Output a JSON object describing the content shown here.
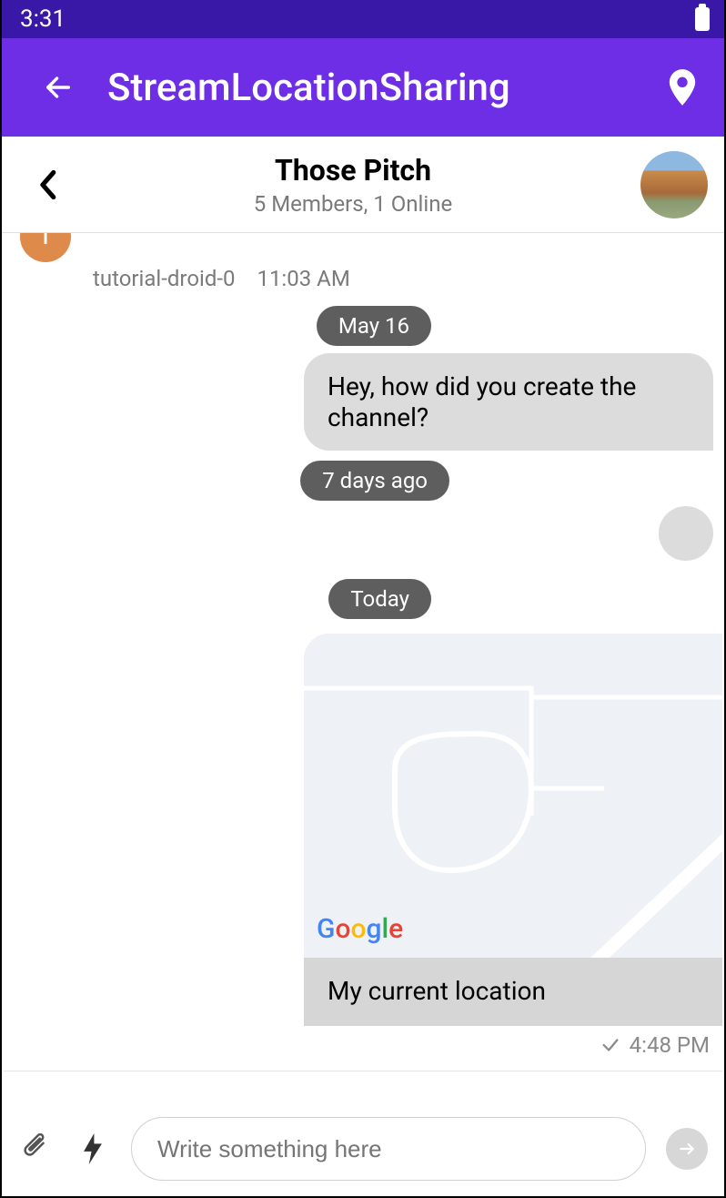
{
  "status": {
    "time": "3:31"
  },
  "appbar": {
    "title": "StreamLocationSharing"
  },
  "channel": {
    "name": "Those Pitch",
    "subtitle": "5 Members, 1 Online",
    "avatar_initial": "T"
  },
  "messages": {
    "prev_sender": "tutorial-droid-0",
    "prev_time": "11:03 AM",
    "date_pill_1": "May 16",
    "bubble_1": "Hey, how did you create the channel?",
    "date_pill_2": "7 days ago",
    "date_pill_3": "Today",
    "map_attribution": "Google",
    "map_label": "My current location",
    "sent_time": "4:48 PM"
  },
  "input": {
    "placeholder": "Write something here"
  }
}
